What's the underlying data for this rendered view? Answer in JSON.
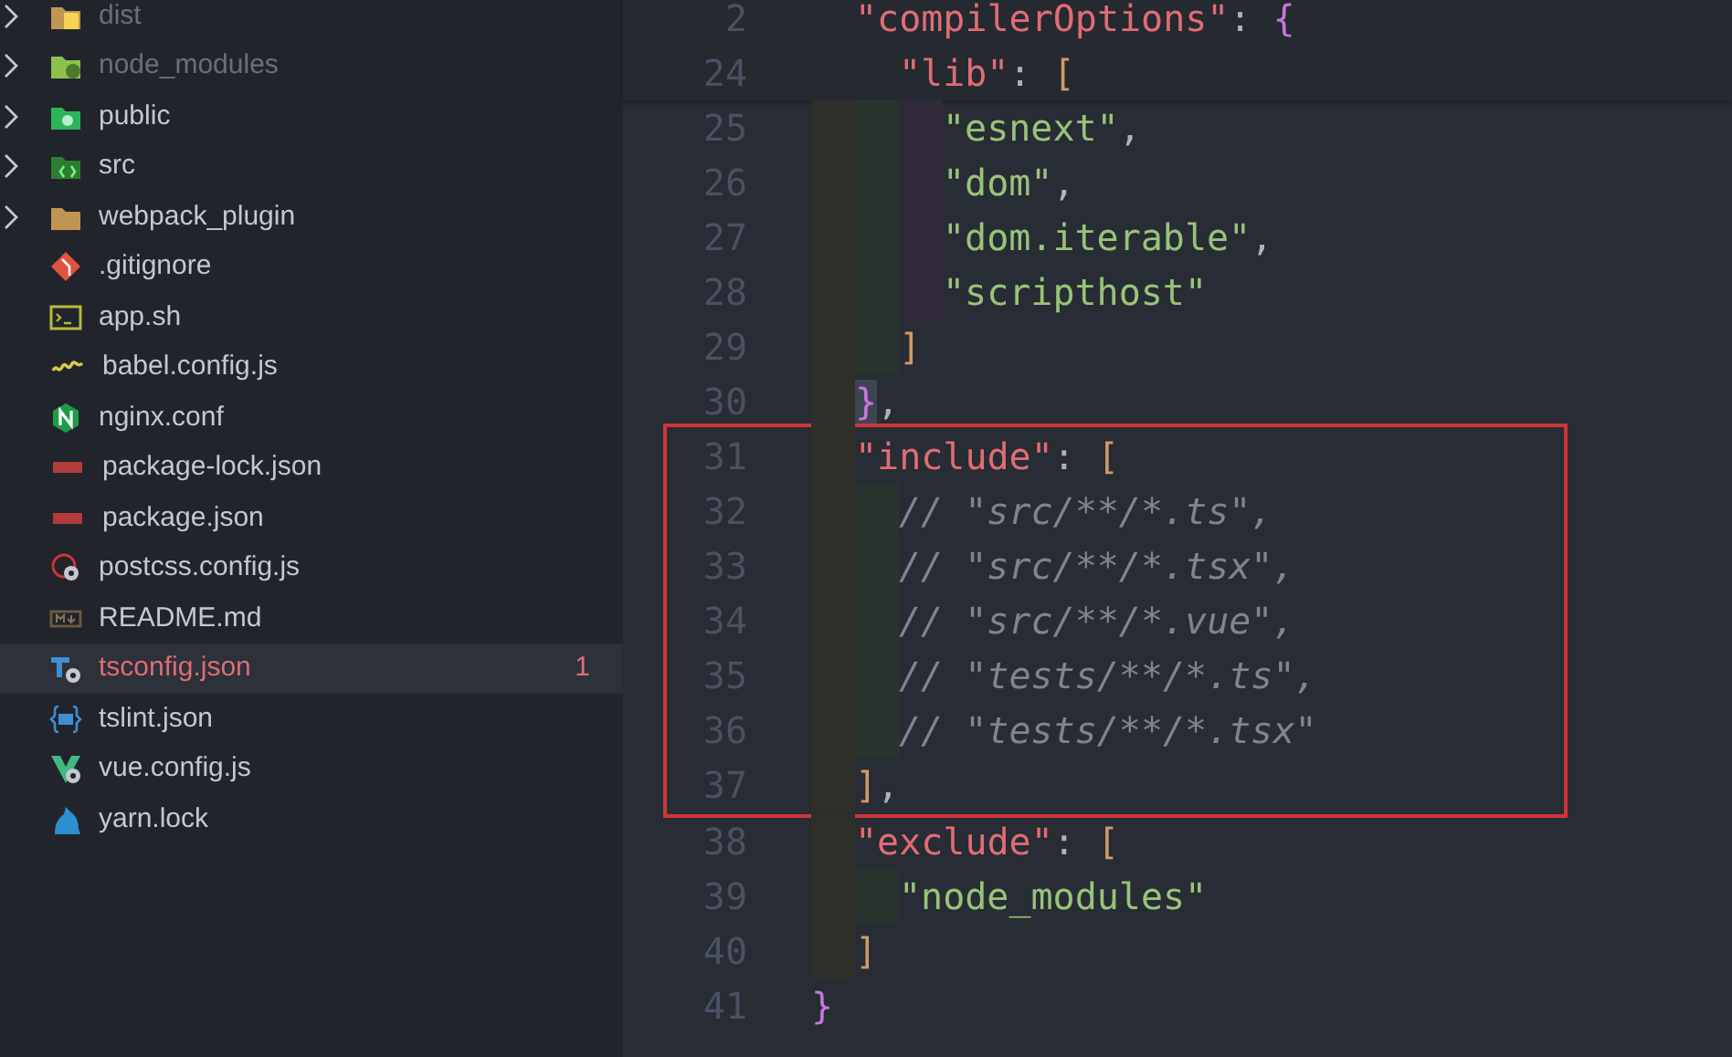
{
  "sidebar": {
    "items": [
      {
        "kind": "folder",
        "label": "dist",
        "dimmed": true,
        "selected": false
      },
      {
        "kind": "folder",
        "label": "node_modules",
        "dimmed": true,
        "selected": false
      },
      {
        "kind": "folder",
        "label": "public",
        "dimmed": false,
        "selected": false
      },
      {
        "kind": "folder",
        "label": "src",
        "dimmed": false,
        "selected": false
      },
      {
        "kind": "folder",
        "label": "webpack_plugin",
        "dimmed": false,
        "selected": false
      },
      {
        "kind": "file",
        "label": ".gitignore",
        "dimmed": false,
        "selected": false
      },
      {
        "kind": "file",
        "label": "app.sh",
        "dimmed": false,
        "selected": false
      },
      {
        "kind": "file",
        "label": "babel.config.js",
        "dimmed": false,
        "selected": false
      },
      {
        "kind": "file",
        "label": "nginx.conf",
        "dimmed": false,
        "selected": false
      },
      {
        "kind": "file",
        "label": "package-lock.json",
        "dimmed": false,
        "selected": false
      },
      {
        "kind": "file",
        "label": "package.json",
        "dimmed": false,
        "selected": false
      },
      {
        "kind": "file",
        "label": "postcss.config.js",
        "dimmed": false,
        "selected": false
      },
      {
        "kind": "file",
        "label": "README.md",
        "dimmed": false,
        "selected": false
      },
      {
        "kind": "file",
        "label": "tsconfig.json",
        "dimmed": false,
        "selected": true,
        "error_count": "1"
      },
      {
        "kind": "file",
        "label": "tslint.json",
        "dimmed": false,
        "selected": false
      },
      {
        "kind": "file",
        "label": "vue.config.js",
        "dimmed": false,
        "selected": false
      },
      {
        "kind": "file",
        "label": "yarn.lock",
        "dimmed": false,
        "selected": false
      }
    ]
  },
  "editor": {
    "body": [
      {
        "number": "2",
        "sticky": true,
        "boxed": false,
        "tokens": [
          {
            "kind": "key",
            "text": "\"compilerOptions\""
          },
          {
            "kind": "punct",
            "text": ": "
          },
          {
            "kind": "brace",
            "text": "{"
          }
        ],
        "children": [
          {
            "number": "24",
            "sticky": true,
            "boxed": false,
            "tokens": [
              {
                "kind": "key",
                "text": "\"lib\""
              },
              {
                "kind": "punct",
                "text": ": "
              },
              {
                "kind": "bracket",
                "text": "["
              }
            ],
            "children": [
              {
                "number": "25",
                "sticky": false,
                "boxed": false,
                "tokens": [
                  {
                    "kind": "string",
                    "text": "\"esnext\""
                  },
                  {
                    "kind": "punct",
                    "text": ","
                  }
                ]
              },
              {
                "number": "26",
                "sticky": false,
                "boxed": false,
                "tokens": [
                  {
                    "kind": "string",
                    "text": "\"dom\""
                  },
                  {
                    "kind": "punct",
                    "text": ","
                  }
                ]
              },
              {
                "number": "27",
                "sticky": false,
                "boxed": false,
                "tokens": [
                  {
                    "kind": "string",
                    "text": "\"dom.iterable\""
                  },
                  {
                    "kind": "punct",
                    "text": ","
                  }
                ]
              },
              {
                "number": "28",
                "sticky": false,
                "boxed": false,
                "tokens": [
                  {
                    "kind": "string",
                    "text": "\"scripthost\""
                  }
                ]
              }
            ]
          },
          {
            "number": "29",
            "sticky": false,
            "boxed": false,
            "tokens": [
              {
                "kind": "bracket",
                "text": "]"
              }
            ]
          }
        ]
      },
      {
        "number": "30",
        "sticky": false,
        "boxed": false,
        "tokens": [
          {
            "kind": "brace_match",
            "text": "}"
          },
          {
            "kind": "punct",
            "text": ","
          }
        ]
      },
      {
        "number": "31",
        "sticky": false,
        "boxed": true,
        "tokens": [
          {
            "kind": "key",
            "text": "\"include\""
          },
          {
            "kind": "punct",
            "text": ": "
          },
          {
            "kind": "bracket",
            "text": "["
          }
        ],
        "children": [
          {
            "number": "32",
            "sticky": false,
            "boxed": true,
            "tokens": [
              {
                "kind": "comment",
                "text": "// \"src/**/*.ts\","
              }
            ]
          },
          {
            "number": "33",
            "sticky": false,
            "boxed": true,
            "tokens": [
              {
                "kind": "comment",
                "text": "// \"src/**/*.tsx\","
              }
            ]
          },
          {
            "number": "34",
            "sticky": false,
            "boxed": true,
            "tokens": [
              {
                "kind": "comment",
                "text": "// \"src/**/*.vue\","
              }
            ]
          },
          {
            "number": "35",
            "sticky": false,
            "boxed": true,
            "tokens": [
              {
                "kind": "comment",
                "text": "// \"tests/**/*.ts\","
              }
            ]
          },
          {
            "number": "36",
            "sticky": false,
            "boxed": true,
            "tokens": [
              {
                "kind": "comment",
                "text": "// \"tests/**/*.tsx\""
              }
            ]
          }
        ]
      },
      {
        "number": "37",
        "sticky": false,
        "boxed": true,
        "tokens": [
          {
            "kind": "bracket",
            "text": "]"
          },
          {
            "kind": "punct",
            "text": ","
          }
        ]
      },
      {
        "number": "38",
        "sticky": false,
        "boxed": false,
        "tokens": [
          {
            "kind": "key",
            "text": "\"exclude\""
          },
          {
            "kind": "punct",
            "text": ": "
          },
          {
            "kind": "bracket",
            "text": "["
          }
        ],
        "children": [
          {
            "number": "39",
            "sticky": false,
            "boxed": false,
            "tokens": [
              {
                "kind": "string",
                "text": "\"node_modules\""
              }
            ]
          }
        ]
      },
      {
        "number": "40",
        "sticky": false,
        "boxed": false,
        "tokens": [
          {
            "kind": "bracket",
            "text": "]"
          }
        ]
      }
    ],
    "closing_line": {
      "number": "41",
      "tokens": [
        {
          "kind": "brace",
          "text": "}"
        }
      ]
    }
  }
}
